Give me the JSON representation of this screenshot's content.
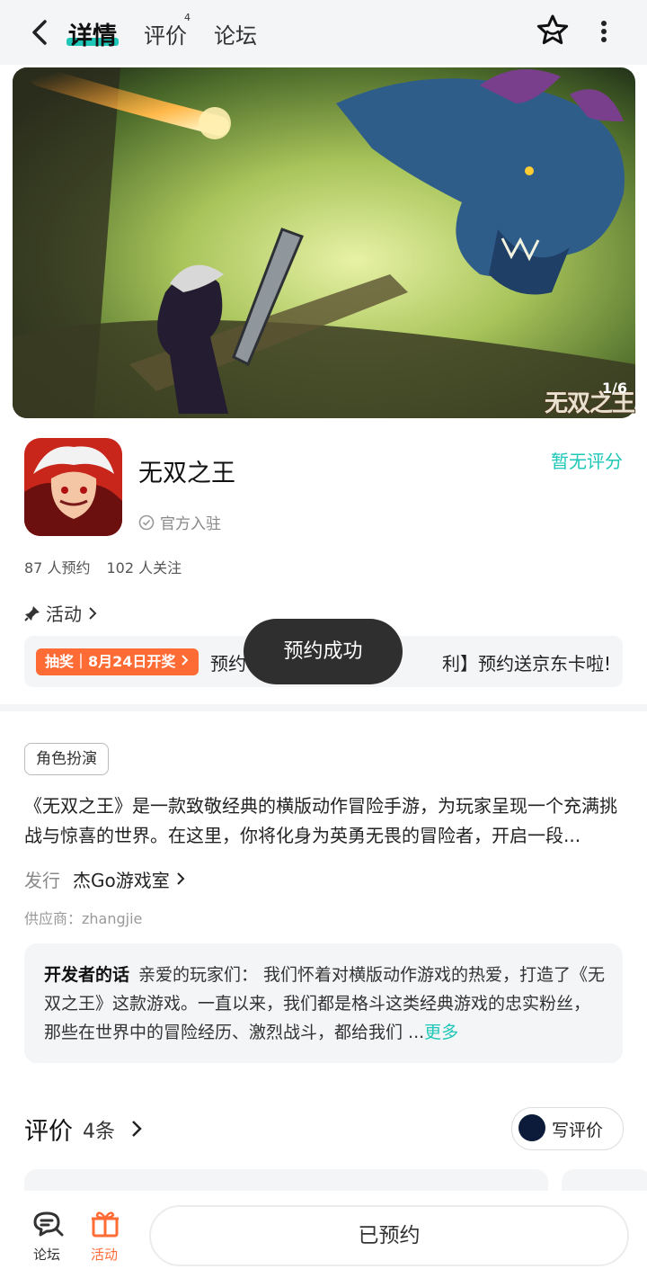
{
  "header": {
    "tabs": [
      {
        "label": "详情"
      },
      {
        "label": "评价",
        "badge": "4"
      },
      {
        "label": "论坛"
      }
    ]
  },
  "hero": {
    "counter": "1/6",
    "logo_text": "无双之王"
  },
  "app": {
    "name": "无双之王",
    "official": "官方入驻",
    "rating": "暂无评分",
    "reservations": "87 人预约",
    "followers": "102 人关注"
  },
  "activity": {
    "title": "活动",
    "tag": "抽奖｜8月24日开奖",
    "text_left": "预约",
    "text_right": "利】预约送京东卡啦!"
  },
  "toast": "预约成功",
  "details": {
    "genre": "角色扮演",
    "description": "《无双之王》是一款致敬经典的横版动作冒险手游，为玩家呈现一个充满挑战与惊喜的世界。在这里，你将化身为英勇无畏的冒险者，开启一段...",
    "publisher_label": "发行",
    "publisher": "杰Go游戏室",
    "supplier": "供应商：zhangjie"
  },
  "developer": {
    "label": "开发者的话",
    "text": "亲爱的玩家们： 我们怀着对横版动作游戏的热爱，打造了《无双之王》这款游戏。一直以来，我们都是格斗这类经典游戏的忠实粉丝，那些在世界中的冒险经历、激烈战斗，都给我们 ...",
    "more": "更多"
  },
  "reviews": {
    "title": "评价",
    "count": "4条",
    "write_label": "写评价"
  },
  "bottom": {
    "forum_label": "论坛",
    "activity_label": "活动",
    "reserve_label": "已预约"
  },
  "colors": {
    "accent": "#1ec7b7",
    "orange": "#ff6b35",
    "toast_bg": "#2f2f2f"
  }
}
